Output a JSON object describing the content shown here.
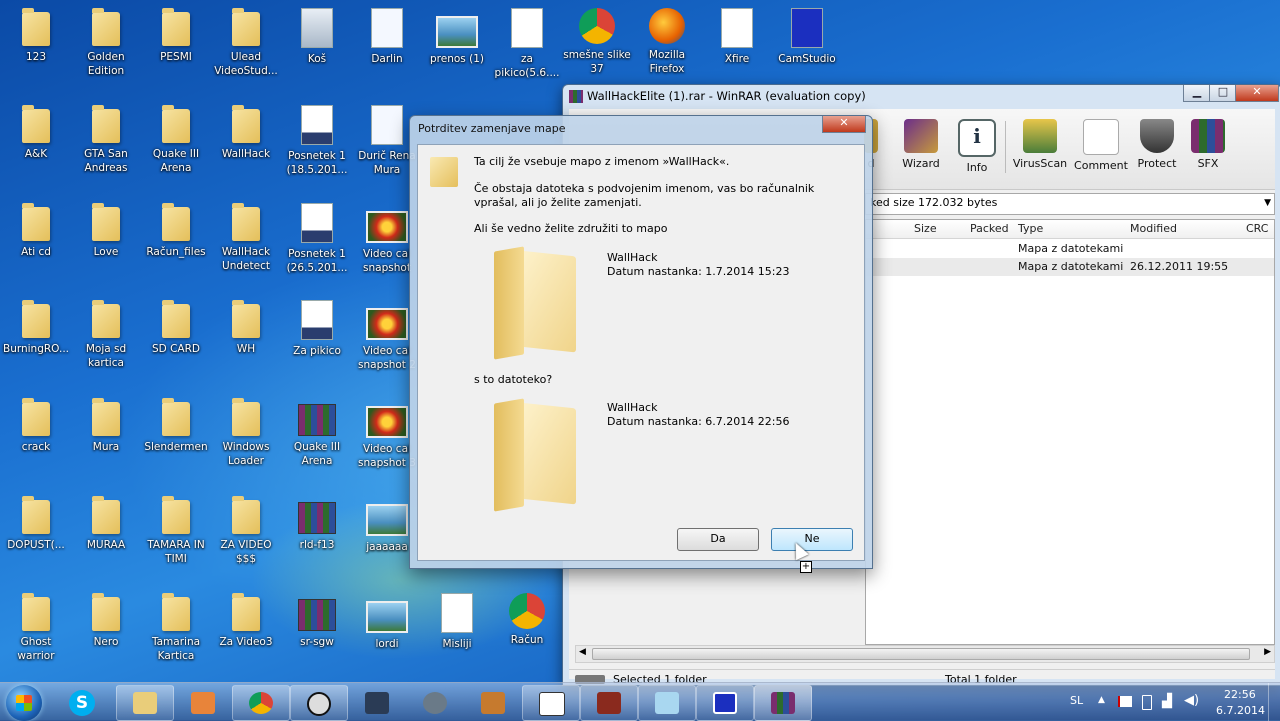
{
  "desktop": {
    "icons": [
      {
        "label": "123",
        "kind": "folder"
      },
      {
        "label": "Golden\nEdition",
        "kind": "folder"
      },
      {
        "label": "PESMI",
        "kind": "folder"
      },
      {
        "label": "Ulead\nVideoStud...",
        "kind": "folder"
      },
      {
        "label": "Koš",
        "kind": "recycle"
      },
      {
        "label": "Darlin",
        "kind": "doc"
      },
      {
        "label": "prenos (1)",
        "kind": "image"
      },
      {
        "label": "za\npikico(5.6....",
        "kind": "word"
      },
      {
        "label": "smešne slike\n37",
        "kind": "chrome"
      },
      {
        "label": "Mozilla\nFirefox",
        "kind": "firefox"
      },
      {
        "label": "Xfire",
        "kind": "xfire"
      },
      {
        "label": "CamStudio",
        "kind": "camstudio"
      },
      {
        "label": "A&K",
        "kind": "folder"
      },
      {
        "label": "GTA San\nAndreas",
        "kind": "folder"
      },
      {
        "label": "Quake III\nArena",
        "kind": "folder"
      },
      {
        "label": "WallHack",
        "kind": "folder"
      },
      {
        "label": "Posnetek 1\n(18.5.201...",
        "kind": "wmv"
      },
      {
        "label": "Durič Rena\nMura",
        "kind": "doc"
      },
      {
        "label": "Ati cd",
        "kind": "folder"
      },
      {
        "label": "Love",
        "kind": "folder"
      },
      {
        "label": "Račun_files",
        "kind": "folder"
      },
      {
        "label": "WallHack\nUndetect",
        "kind": "folder"
      },
      {
        "label": "Posnetek 1\n(26.5.201...",
        "kind": "wmv"
      },
      {
        "label": "Video cal\nsnapshot",
        "kind": "flower"
      },
      {
        "label": "BurningRO...",
        "kind": "folder"
      },
      {
        "label": "Moja sd\nkartica",
        "kind": "folder"
      },
      {
        "label": "SD CARD",
        "kind": "folder"
      },
      {
        "label": "WH",
        "kind": "folder"
      },
      {
        "label": "Za pikico",
        "kind": "wmv"
      },
      {
        "label": "Video cal\nsnapshot 2",
        "kind": "flower"
      },
      {
        "label": "crack",
        "kind": "folder"
      },
      {
        "label": "Mura",
        "kind": "folder"
      },
      {
        "label": "Slendermen",
        "kind": "folder"
      },
      {
        "label": "Windows\nLoader",
        "kind": "folder"
      },
      {
        "label": "Quake III\nArena",
        "kind": "rar"
      },
      {
        "label": "Video cal\nsnapshot 3",
        "kind": "flower"
      },
      {
        "label": "DOPUST(...",
        "kind": "folder"
      },
      {
        "label": "MURAA",
        "kind": "folder"
      },
      {
        "label": "TAMARA IN\nTIMI",
        "kind": "folder"
      },
      {
        "label": "ZA VIDEO\n$$$",
        "kind": "folder"
      },
      {
        "label": "rld-f13",
        "kind": "rar"
      },
      {
        "label": "jaaaaaa",
        "kind": "image"
      },
      {
        "label": "Ghost warrior",
        "kind": "folder"
      },
      {
        "label": "Nero",
        "kind": "folder"
      },
      {
        "label": "Tamarina\nKartica",
        "kind": "folder"
      },
      {
        "label": "Za Video3",
        "kind": "folder"
      },
      {
        "label": "sr-sgw",
        "kind": "rar"
      },
      {
        "label": "lordi",
        "kind": "image"
      },
      {
        "label": "Misliji",
        "kind": "word"
      },
      {
        "label": "Račun",
        "kind": "chrome"
      }
    ]
  },
  "winrar": {
    "title": "WallHackElite (1).rar - WinRAR (evaluation copy)",
    "toolbar": [
      "d",
      "Wizard",
      "Info",
      "VirusScan",
      "Comment",
      "Protect",
      "SFX"
    ],
    "path_text": "ked size 172.032 bytes",
    "columns": [
      "Size",
      "Packed",
      "Type",
      "Modified",
      "CRC"
    ],
    "rows": [
      {
        "type": "Mapa z datotekami",
        "modified": ""
      },
      {
        "type": "Mapa z datotekami",
        "modified": "26.12.2011 19:55"
      }
    ],
    "status_left": "Selected 1 folder",
    "status_right": "Total 1 folder",
    "controls": {
      "minimize": "▁",
      "maximize": "□",
      "close": "✕"
    }
  },
  "dialog": {
    "title": "Potrditev zamenjave mape",
    "line1": "Ta cilj že vsebuje mapo z imenom »WallHack«.",
    "line2": "Če obstaja datoteka s podvojenim imenom, vas bo računalnik vprašal, ali jo želite zamenjati.",
    "question": "Ali še vedno želite združiti to mapo",
    "existing_name": "WallHack",
    "existing_date": "Datum nastanka: 1.7.2014 15:23",
    "with_text": "s to datoteko?",
    "new_name": "WallHack",
    "new_date": "Datum nastanka: 6.7.2014 22:56",
    "yes": "Da",
    "no": "Ne",
    "close": "✕"
  },
  "taskbar": {
    "lang": "SL",
    "time": "22:56",
    "date": "6.7.2014",
    "skype_letter": "S"
  }
}
